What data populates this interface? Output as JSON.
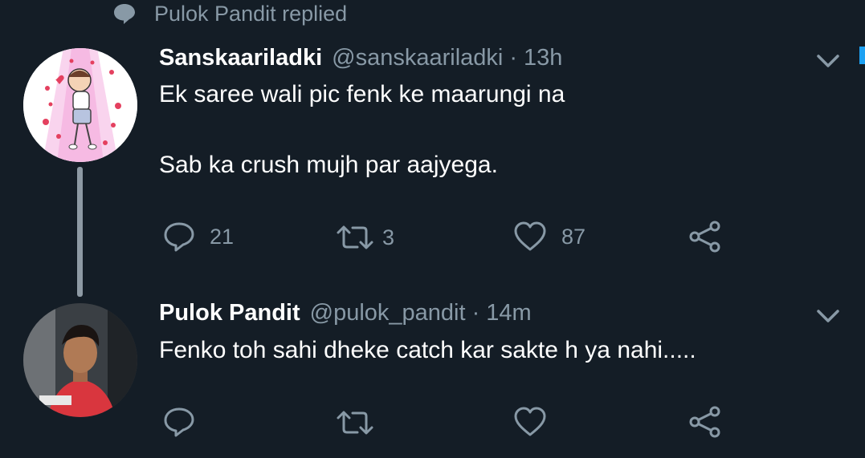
{
  "context": {
    "label": "Pulok Pandit replied",
    "icon": "speech-bubble-icon"
  },
  "tweets": [
    {
      "display_name": "Sanskaariladki",
      "handle": "@sanskaariladki",
      "separator": "·",
      "time": "13h",
      "lines": [
        "Ek saree wali pic fenk ke maarungi na",
        "Sab ka crush mujh par aajyega."
      ],
      "reply_count": "21",
      "retweet_count": "3",
      "like_count": "87"
    },
    {
      "display_name": "Pulok Pandit",
      "handle": "@pulok_pandit",
      "separator": "·",
      "time": "14m",
      "lines": [
        "Fenko toh sahi dheke catch kar sakte h ya nahi....."
      ],
      "reply_count": "",
      "retweet_count": "",
      "like_count": ""
    }
  ],
  "colors": {
    "background": "#141d26",
    "secondary_text": "#8899a6",
    "primary_text": "#ffffff",
    "accent": "#1da1f2"
  }
}
